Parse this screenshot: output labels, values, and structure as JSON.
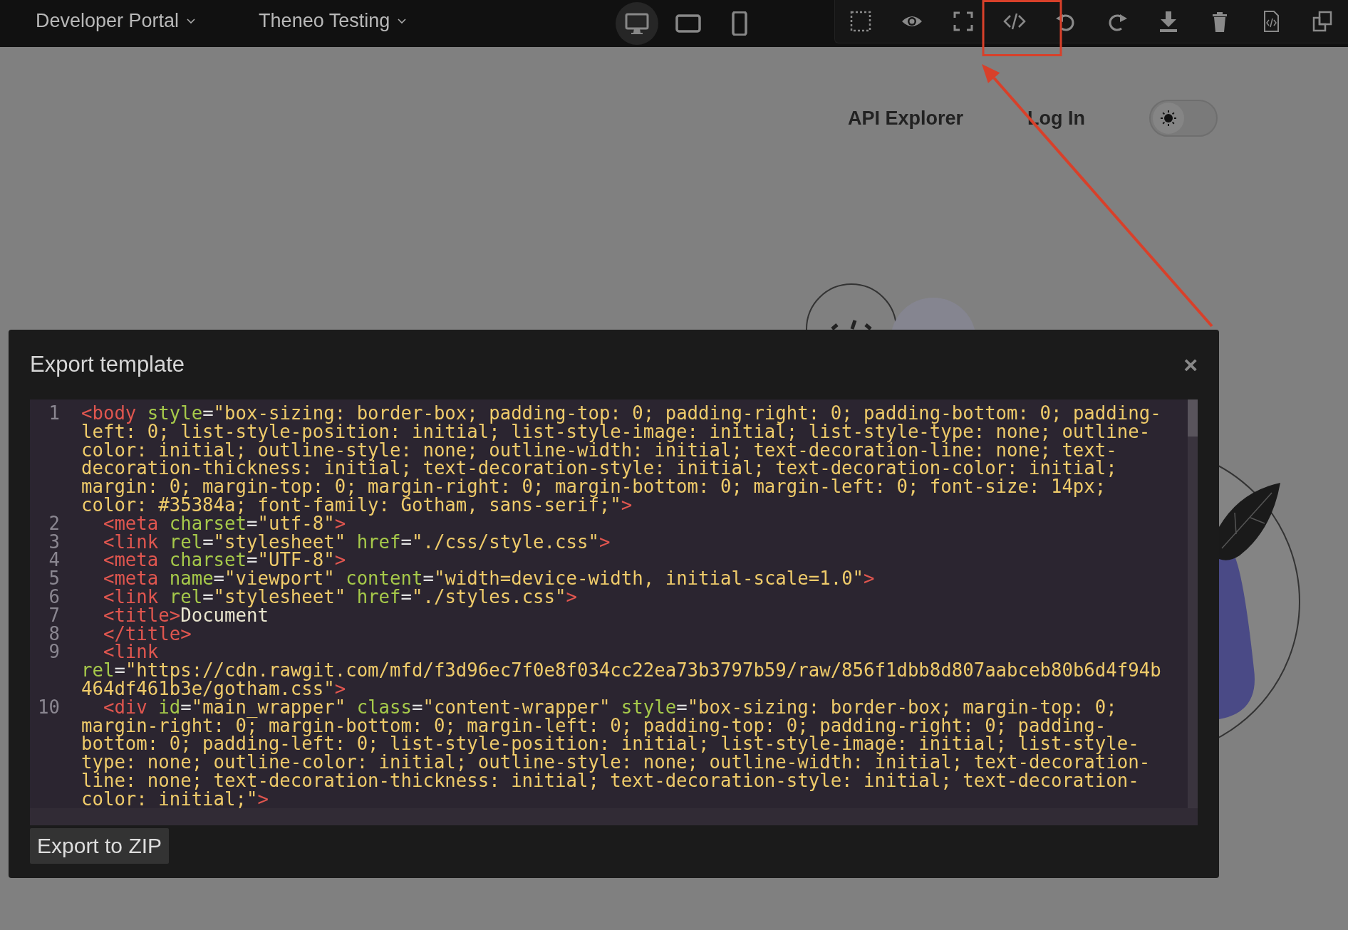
{
  "topbar": {
    "menus": [
      {
        "label": "Developer Portal"
      },
      {
        "label": "Theneo Testing"
      }
    ],
    "devices": [
      {
        "kind": "desktop",
        "selected": true
      },
      {
        "kind": "tablet",
        "selected": false
      },
      {
        "kind": "mobile",
        "selected": false
      }
    ],
    "tools": [
      {
        "kind": "select-area",
        "annotated": false
      },
      {
        "kind": "preview",
        "annotated": false
      },
      {
        "kind": "fullscreen",
        "annotated": false
      },
      {
        "kind": "code",
        "annotated": true
      },
      {
        "kind": "undo",
        "annotated": false
      },
      {
        "kind": "redo",
        "annotated": false
      },
      {
        "kind": "download",
        "annotated": false
      },
      {
        "kind": "delete",
        "annotated": false
      },
      {
        "kind": "code-file",
        "annotated": false
      },
      {
        "kind": "copy",
        "annotated": false
      }
    ]
  },
  "page_nav": {
    "links": [
      {
        "label": "API Explorer"
      },
      {
        "label": "Log In"
      }
    ],
    "theme_toggle": {
      "on": false
    }
  },
  "modal": {
    "title": "Export template",
    "close": "×",
    "lines": [
      {
        "number": "1",
        "tokens": [
          {
            "kind": "tag",
            "text": "<body"
          },
          {
            "kind": "attr",
            "text": " style"
          },
          {
            "kind": "punct",
            "text": "="
          },
          {
            "kind": "string",
            "text": "\"box-sizing: border-box; padding-top: 0; padding-right: 0; padding-bottom: 0; padding-left: 0; list-style-position: initial; list-style-image: initial; list-style-type: none; outline-color: initial; outline-style: none; outline-width: initial; text-decoration-line: none; text-decoration-thickness: initial; text-decoration-style: initial; text-decoration-color: initial; margin: 0; margin-top: 0; margin-right: 0; margin-bottom: 0; margin-left: 0; font-size: 14px; color: #35384a; font-family: Gotham, sans-serif;\""
          },
          {
            "kind": "tag",
            "text": ">"
          }
        ]
      },
      {
        "number": "2",
        "tokens": [
          {
            "kind": "tag",
            "text": "  <meta"
          },
          {
            "kind": "attr",
            "text": " charset"
          },
          {
            "kind": "punct",
            "text": "="
          },
          {
            "kind": "string",
            "text": "\"utf-8\""
          },
          {
            "kind": "tag",
            "text": ">"
          }
        ]
      },
      {
        "number": "3",
        "tokens": [
          {
            "kind": "tag",
            "text": "  <link"
          },
          {
            "kind": "attr",
            "text": " rel"
          },
          {
            "kind": "punct",
            "text": "="
          },
          {
            "kind": "string",
            "text": "\"stylesheet\""
          },
          {
            "kind": "attr",
            "text": " href"
          },
          {
            "kind": "punct",
            "text": "="
          },
          {
            "kind": "string",
            "text": "\"./css/style.css\""
          },
          {
            "kind": "tag",
            "text": ">"
          }
        ]
      },
      {
        "number": "4",
        "tokens": [
          {
            "kind": "tag",
            "text": "  <meta"
          },
          {
            "kind": "attr",
            "text": " charset"
          },
          {
            "kind": "punct",
            "text": "="
          },
          {
            "kind": "string",
            "text": "\"UTF-8\""
          },
          {
            "kind": "tag",
            "text": ">"
          }
        ]
      },
      {
        "number": "5",
        "tokens": [
          {
            "kind": "tag",
            "text": "  <meta"
          },
          {
            "kind": "attr",
            "text": " name"
          },
          {
            "kind": "punct",
            "text": "="
          },
          {
            "kind": "string",
            "text": "\"viewport\""
          },
          {
            "kind": "attr",
            "text": " content"
          },
          {
            "kind": "punct",
            "text": "="
          },
          {
            "kind": "string",
            "text": "\"width=device-width, initial-scale=1.0\""
          },
          {
            "kind": "tag",
            "text": ">"
          }
        ]
      },
      {
        "number": "6",
        "tokens": [
          {
            "kind": "tag",
            "text": "  <link"
          },
          {
            "kind": "attr",
            "text": " rel"
          },
          {
            "kind": "punct",
            "text": "="
          },
          {
            "kind": "string",
            "text": "\"stylesheet\""
          },
          {
            "kind": "attr",
            "text": " href"
          },
          {
            "kind": "punct",
            "text": "="
          },
          {
            "kind": "string",
            "text": "\"./styles.css\""
          },
          {
            "kind": "tag",
            "text": ">"
          }
        ]
      },
      {
        "number": "7",
        "tokens": [
          {
            "kind": "tag",
            "text": "  <title>"
          },
          {
            "kind": "text",
            "text": "Document"
          }
        ]
      },
      {
        "number": "8",
        "tokens": [
          {
            "kind": "tag",
            "text": "  </title>"
          }
        ]
      },
      {
        "number": "9",
        "tokens": [
          {
            "kind": "tag",
            "text": "  <link"
          },
          {
            "kind": "attr",
            "text": " rel"
          },
          {
            "kind": "punct",
            "text": "="
          },
          {
            "kind": "string",
            "text": "\"https://cdn.rawgit.com/mfd/f3d96ec7f0e8f034cc22ea73b3797b59/raw/856f1dbb8d807aabceb80b6d4f94b464df461b3e/gotham.css\""
          },
          {
            "kind": "tag",
            "text": ">"
          }
        ]
      },
      {
        "number": "10",
        "tokens": [
          {
            "kind": "tag",
            "text": "  <div"
          },
          {
            "kind": "attr",
            "text": " id"
          },
          {
            "kind": "punct",
            "text": "="
          },
          {
            "kind": "string",
            "text": "\"main_wrapper\""
          },
          {
            "kind": "attr",
            "text": " class"
          },
          {
            "kind": "punct",
            "text": "="
          },
          {
            "kind": "string",
            "text": "\"content-wrapper\""
          },
          {
            "kind": "attr",
            "text": " style"
          },
          {
            "kind": "punct",
            "text": "="
          },
          {
            "kind": "string",
            "text": "\"box-sizing: border-box; margin-top: 0; margin-right: 0; margin-bottom: 0; margin-left: 0; padding-top: 0; padding-right: 0; padding-bottom: 0; padding-left: 0; list-style-position: initial; list-style-image: initial; list-style-type: none; outline-color: initial; outline-style: none; outline-width: initial; text-decoration-line: none; text-decoration-thickness: initial; text-decoration-style: initial; text-decoration-color: initial;\""
          },
          {
            "kind": "tag",
            "text": ">"
          }
        ]
      }
    ],
    "export_button": "Export to ZIP"
  }
}
